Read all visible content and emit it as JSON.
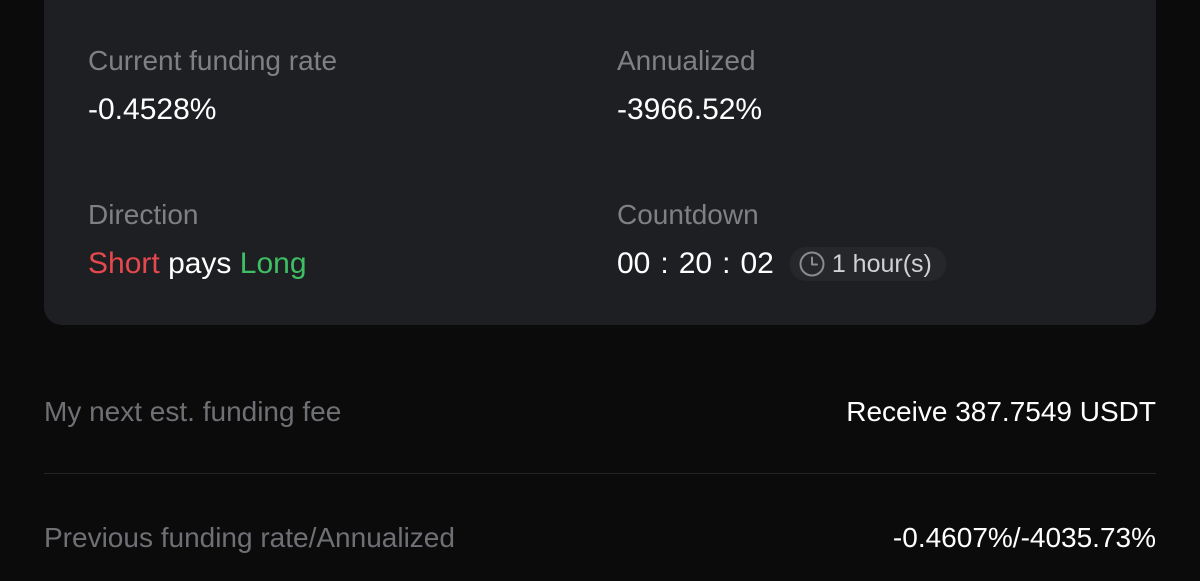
{
  "funding_panel": {
    "current_rate": {
      "label": "Current funding rate",
      "value": "-0.4528%"
    },
    "annualized": {
      "label": "Annualized",
      "value": "-3966.52%"
    },
    "direction": {
      "label": "Direction",
      "payer": "Short",
      "verb": "pays",
      "receiver": "Long",
      "payer_color": "#e5484d",
      "receiver_color": "#3fbf63"
    },
    "countdown": {
      "label": "Countdown",
      "hours": "00",
      "minutes": "20",
      "seconds": "02",
      "separator": ":",
      "interval_icon": "clock-icon",
      "interval_text": "1 hour(s)"
    }
  },
  "details": {
    "next_fee": {
      "label": "My next est. funding fee",
      "value": "Receive 387.7549 USDT"
    },
    "previous_rate": {
      "label": "Previous funding rate/Annualized",
      "value": "-0.4607%/-4035.73%"
    }
  }
}
